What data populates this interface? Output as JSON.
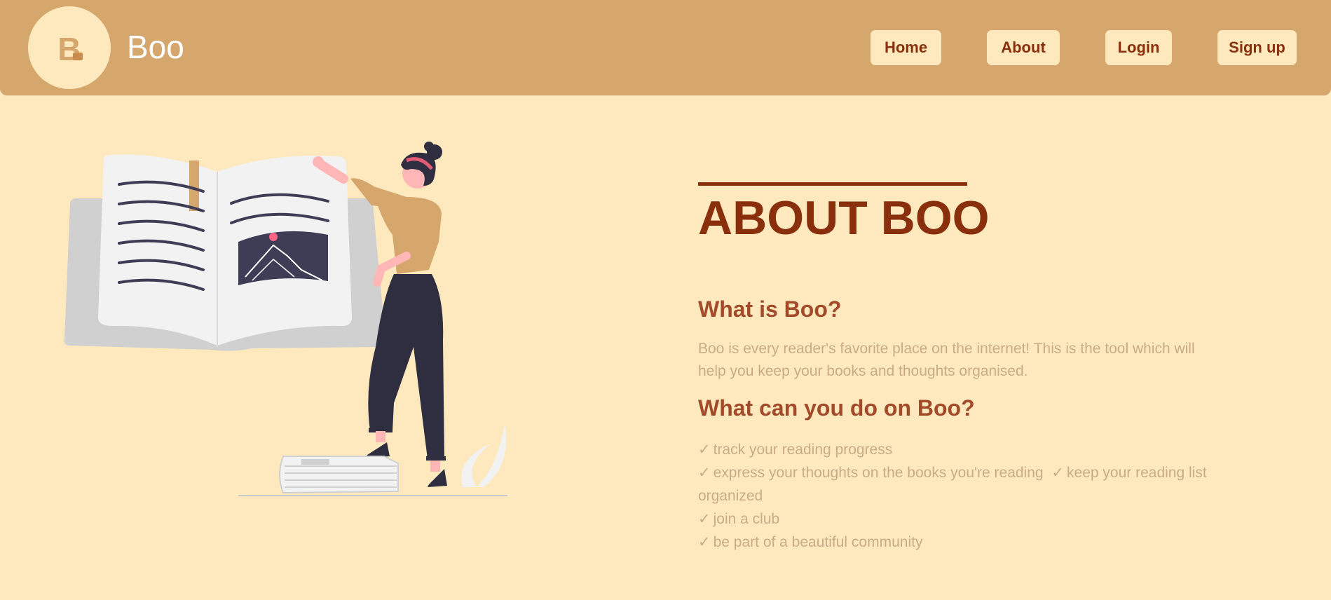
{
  "brand": {
    "logo_letter": "B",
    "name": "Boo"
  },
  "nav": [
    {
      "label": "Home"
    },
    {
      "label": "About"
    },
    {
      "label": "Login"
    },
    {
      "label": "Sign up"
    }
  ],
  "about": {
    "title": "ABOUT BOO",
    "what_is_heading": "What is Boo?",
    "what_is_text": "Boo is every reader's favorite place on the internet! This is the tool which will help you keep your books and thoughts organised.",
    "what_can_heading": "What can you do on Boo?",
    "features": [
      {
        "check": "✓",
        "text": "track your reading progress"
      },
      {
        "check": "✓",
        "text": "express your thoughts on the books you're reading"
      },
      {
        "check": "✓",
        "text": "keep your reading list organized"
      },
      {
        "check": "✓",
        "text": "join a club"
      },
      {
        "check": "✓",
        "text": "be part of a beautiful community"
      }
    ]
  },
  "colors": {
    "header_bg": "#d6a76d",
    "page_bg": "#fde9bd",
    "accent": "#8a2f0b",
    "heading": "#a24a2a",
    "body_text": "#c9ab89"
  }
}
